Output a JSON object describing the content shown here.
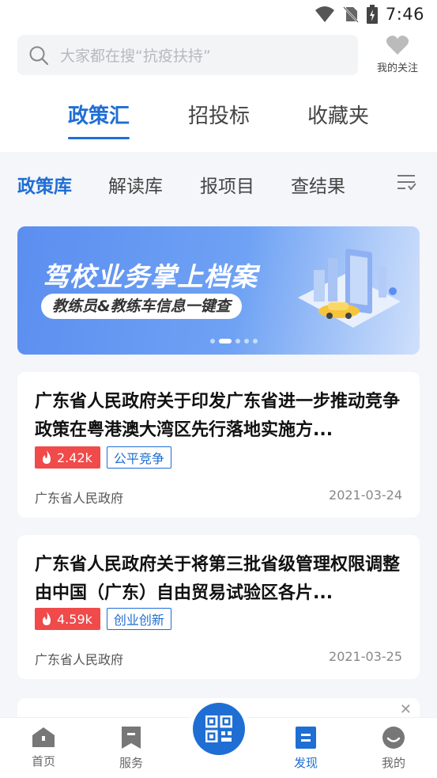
{
  "status_bar": {
    "time": "7:46"
  },
  "search": {
    "placeholder": "大家都在搜“抗疫扶持”"
  },
  "follow": {
    "label": "我的关注"
  },
  "top_tabs": [
    {
      "label": "政策汇",
      "active": true
    },
    {
      "label": "招投标",
      "active": false
    },
    {
      "label": "收藏夹",
      "active": false
    }
  ],
  "sub_tabs": [
    {
      "label": "政策库",
      "active": true
    },
    {
      "label": "解读库",
      "active": false
    },
    {
      "label": "报项目",
      "active": false
    },
    {
      "label": "查结果",
      "active": false
    }
  ],
  "banner": {
    "headline": "驾校业务掌上档案",
    "subline": "教练员&教练车信息一键查",
    "slide_count": 5,
    "active_slide": 2
  },
  "cards": [
    {
      "title": "广东省人民政府关于印发广东省进一步推动竞争政策在粤港澳大湾区先行落地实施方...",
      "hot": "2.42k",
      "tag": "公平竞争",
      "source": "广东省人民政府",
      "date": "2021-03-24"
    },
    {
      "title": "广东省人民政府关于将第三批省级管理权限调整由中国（广东）自由贸易试验区各片...",
      "hot": "4.59k",
      "tag": "创业创新",
      "source": "广东省人民政府",
      "date": "2021-03-25"
    }
  ],
  "bottom_nav": [
    {
      "label": "首页",
      "icon": "home-icon",
      "active": false
    },
    {
      "label": "服务",
      "icon": "bookmark-icon",
      "active": false
    },
    {
      "label": "发现",
      "icon": "discover-icon",
      "active": true
    },
    {
      "label": "我的",
      "icon": "profile-icon",
      "active": false
    }
  ],
  "colors": {
    "accent": "#1f6ed4",
    "hot": "#f04a4a",
    "background": "#f4f6f9"
  }
}
